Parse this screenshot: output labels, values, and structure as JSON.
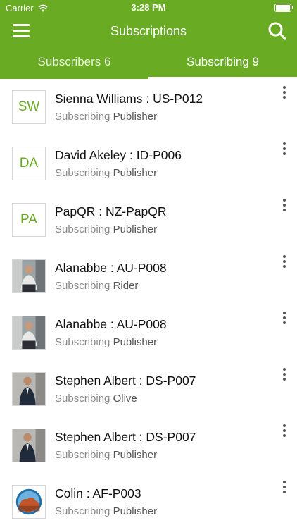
{
  "status_bar": {
    "carrier": "Carrier",
    "time": "3:28 PM"
  },
  "header": {
    "title": "Subscriptions"
  },
  "tabs": [
    {
      "label": "Subscribers 6",
      "active": false
    },
    {
      "label": "Subscribing 9",
      "active": true
    }
  ],
  "list": [
    {
      "name": "Sienna Williams : US-P012",
      "status": "Subscribing",
      "role": "Publisher",
      "initials": "SW"
    },
    {
      "name": "David Akeley : ID-P006",
      "status": "Subscribing",
      "role": "Publisher",
      "initials": "DA"
    },
    {
      "name": "PapQR : NZ-PapQR",
      "status": "Subscribing",
      "role": "Publisher",
      "initials": "PA"
    },
    {
      "name": "Alanabbe : AU-P008",
      "status": "Subscribing",
      "role": "Rider",
      "initials": ""
    },
    {
      "name": "Alanabbe : AU-P008",
      "status": "Subscribing",
      "role": "Publisher",
      "initials": ""
    },
    {
      "name": "Stephen Albert : DS-P007",
      "status": "Subscribing",
      "role": "Olive",
      "initials": ""
    },
    {
      "name": "Stephen Albert : DS-P007",
      "status": "Subscribing",
      "role": "Publisher",
      "initials": ""
    },
    {
      "name": "Colin : AF-P003",
      "status": "Subscribing",
      "role": "Publisher",
      "initials": ""
    }
  ],
  "colors": {
    "accent": "#6aab24"
  }
}
